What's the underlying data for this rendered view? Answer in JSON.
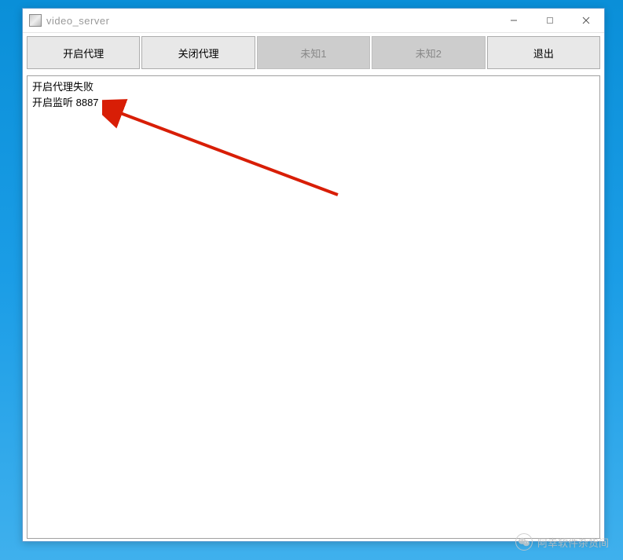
{
  "window": {
    "title": "video_server"
  },
  "toolbar": {
    "open_proxy": "开启代理",
    "close_proxy": "关闭代理",
    "unknown1": "未知1",
    "unknown2": "未知2",
    "exit": "退出"
  },
  "log": {
    "line1": "开启代理失败",
    "line2": "开启监听 8887"
  },
  "watermark": {
    "text": "阿幸软件杂货间"
  }
}
